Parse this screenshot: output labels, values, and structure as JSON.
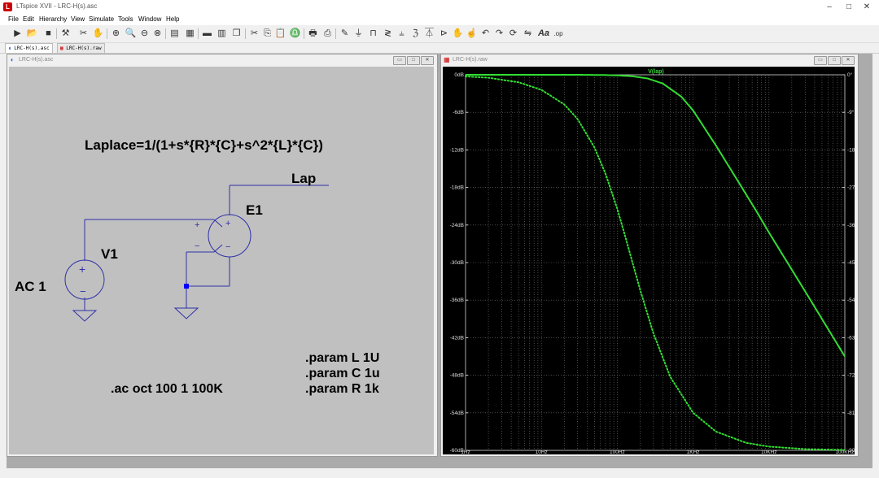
{
  "window": {
    "title": "LTspice XVII - LRC-H(s).asc",
    "minimize": "–",
    "maximize": "□",
    "close": "✕"
  },
  "menu": [
    "File",
    "Edit",
    "Hierarchy",
    "View",
    "Simulate",
    "Tools",
    "Window",
    "Help"
  ],
  "toolbar": {
    "icons": [
      "run-icon",
      "open-icon",
      "save-icon",
      "control-panel-icon",
      "halt-icon",
      "pan-icon",
      "zoom-in-icon",
      "zoom-area-icon",
      "zoom-out-icon",
      "zoom-cancel-icon",
      "autorange-icon",
      "grid-icon",
      "tile-horizontal-icon",
      "tile-vertical-icon",
      "cascade-icon",
      "cut-icon",
      "copy-icon",
      "paste-icon",
      "find-icon",
      "print-icon",
      "print-setup-icon",
      "draw-wire-icon",
      "ground-icon",
      "label-net-icon",
      "resistor-icon",
      "capacitor-icon",
      "inductor-icon",
      "diode-icon",
      "component-icon",
      "move-icon",
      "drag-icon",
      "undo-icon",
      "redo-icon",
      "rotate-icon",
      "mirror-icon",
      "text-icon",
      "spice-directive-icon"
    ],
    "text_glyphs": {
      "text": "Aa",
      "spice": ".op"
    }
  },
  "tabs": [
    "LRC-H(s).asc",
    "LRC-H(s).raw"
  ],
  "schematic": {
    "title": "LRC-H(s).asc",
    "laplace": "Laplace=1/(1+s*{R}*{C}+s^2*{L}*{C})",
    "net_label": "Lap",
    "e1": "E1",
    "v1": "V1",
    "ac": "AC 1",
    "ac_cmd": ".ac oct 100 1 100K",
    "params": [
      ".param L 1U",
      ".param C 1u",
      ".param R 1k"
    ],
    "plus": "+",
    "minus": "−"
  },
  "plot": {
    "title": "LRC-H(s).raw",
    "trace_label": "V(lap)",
    "colors": {
      "trace": "#33dd33",
      "background": "#000000",
      "grid": "#777777"
    }
  },
  "chart_data": {
    "type": "line",
    "title": "V(lap)",
    "x_scale": "log",
    "xlim": [
      1,
      100000
    ],
    "x_ticks": [
      "1Hz",
      "10Hz",
      "100Hz",
      "1KHz",
      "10KHz",
      "100KHz"
    ],
    "ylim": [
      -60,
      0
    ],
    "y_ticks": [
      "0dB",
      "-6dB",
      "-12dB",
      "-18dB",
      "-24dB",
      "-30dB",
      "-36dB",
      "-42dB",
      "-48dB",
      "-54dB",
      "-60dB"
    ],
    "y2lim": [
      -90,
      0
    ],
    "y2_ticks": [
      "0°",
      "-9°",
      "-18°",
      "-27°",
      "-36°",
      "-45°",
      "-54°",
      "-63°",
      "-72°",
      "-81°",
      "-90°"
    ],
    "grid": true,
    "series": [
      {
        "name": "V(lap)",
        "style": "solid",
        "axis": "left",
        "x": [
          1,
          10,
          30,
          60,
          100,
          160,
          250,
          400,
          700,
          1000,
          2000,
          4000,
          7000,
          10000,
          30000,
          100000
        ],
        "y": [
          0,
          0,
          0,
          -0.03,
          -0.09,
          -0.24,
          -0.58,
          -1.4,
          -3.5,
          -5.7,
          -11.3,
          -17.2,
          -22.0,
          -25.2,
          -34.6,
          -45.0
        ]
      },
      {
        "name": "phase",
        "style": "dotted",
        "axis": "right",
        "x": [
          1,
          2,
          5,
          10,
          20,
          30,
          50,
          70,
          100,
          130,
          160,
          200,
          300,
          500,
          1000,
          2000,
          5000,
          10000,
          30000,
          100000
        ],
        "y": [
          -0.4,
          -0.7,
          -1.8,
          -3.6,
          -7.1,
          -10.6,
          -17.4,
          -23.7,
          -32.1,
          -39.3,
          -45.2,
          -51.5,
          -62.0,
          -72.4,
          -81.0,
          -85.5,
          -88.2,
          -89.1,
          -89.7,
          -89.9
        ]
      }
    ]
  }
}
